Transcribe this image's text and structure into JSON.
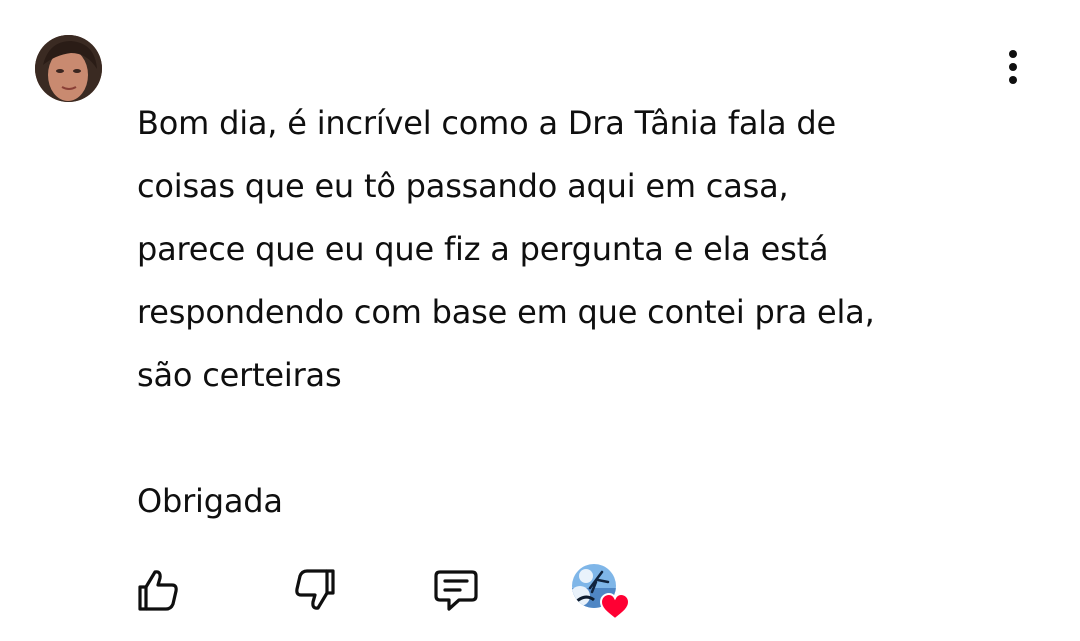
{
  "comment": {
    "text": "Bom dia, é incrível como a Dra Tânia fala de\ncoisas que eu tô passando aqui em casa,\nparece que eu que fiz a pergunta e ela está\nrespondendo com base em que contei pra ela,\nsão certeiras\n\nObrigada"
  },
  "icons": {
    "avatar": "user-avatar",
    "more": "more-vert-icon",
    "like": "thumb-up-icon",
    "dislike": "thumb-down-icon",
    "reply": "comment-icon",
    "creator_heart": "creator-heart-icon"
  },
  "colors": {
    "text": "#0f0f0f",
    "heart": "#ff0033",
    "background": "#ffffff"
  }
}
